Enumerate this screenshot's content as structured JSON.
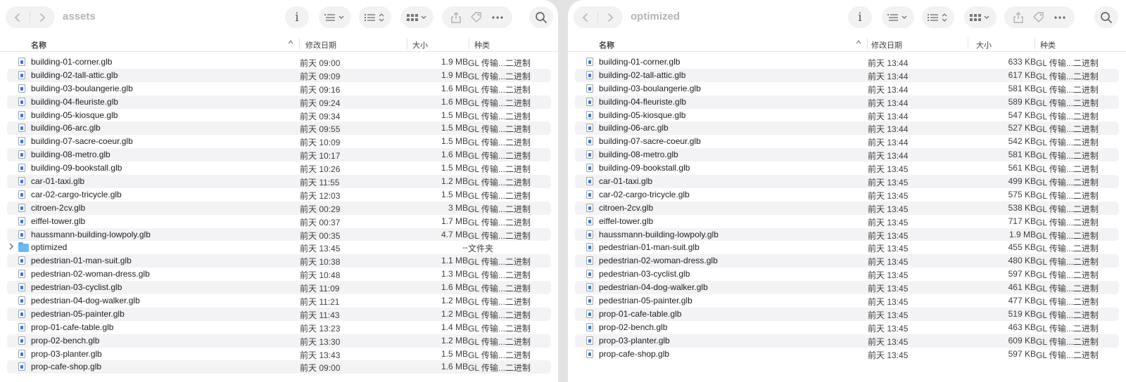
{
  "columns": {
    "name": "名称",
    "date": "修改日期",
    "size": "大小",
    "kind": "种类"
  },
  "left": {
    "title": "assets",
    "rows": [
      {
        "name": "building-01-corner.glb",
        "date": "前天 09:00",
        "size": "1.9 MB",
        "kind": "GL 传输...二进制",
        "type": "file"
      },
      {
        "name": "building-02-tall-attic.glb",
        "date": "前天 09:09",
        "size": "1.9 MB",
        "kind": "GL 传输...二进制",
        "type": "file"
      },
      {
        "name": "building-03-boulangerie.glb",
        "date": "前天 09:16",
        "size": "1.6 MB",
        "kind": "GL 传输...二进制",
        "type": "file"
      },
      {
        "name": "building-04-fleuriste.glb",
        "date": "前天 09:24",
        "size": "1.6 MB",
        "kind": "GL 传输...二进制",
        "type": "file"
      },
      {
        "name": "building-05-kiosque.glb",
        "date": "前天 09:34",
        "size": "1.5 MB",
        "kind": "GL 传输...二进制",
        "type": "file"
      },
      {
        "name": "building-06-arc.glb",
        "date": "前天 09:55",
        "size": "1.5 MB",
        "kind": "GL 传输...二进制",
        "type": "file"
      },
      {
        "name": "building-07-sacre-coeur.glb",
        "date": "前天 10:09",
        "size": "1.5 MB",
        "kind": "GL 传输...二进制",
        "type": "file"
      },
      {
        "name": "building-08-metro.glb",
        "date": "前天 10:17",
        "size": "1.6 MB",
        "kind": "GL 传输...二进制",
        "type": "file"
      },
      {
        "name": "building-09-bookstall.glb",
        "date": "前天 10:26",
        "size": "1.5 MB",
        "kind": "GL 传输...二进制",
        "type": "file"
      },
      {
        "name": "car-01-taxi.glb",
        "date": "前天 11:55",
        "size": "1.2 MB",
        "kind": "GL 传输...二进制",
        "type": "file"
      },
      {
        "name": "car-02-cargo-tricycle.glb",
        "date": "前天 12:03",
        "size": "1.5 MB",
        "kind": "GL 传输...二进制",
        "type": "file"
      },
      {
        "name": "citroen-2cv.glb",
        "date": "前天 00:29",
        "size": "3 MB",
        "kind": "GL 传输...二进制",
        "type": "file"
      },
      {
        "name": "eiffel-tower.glb",
        "date": "前天 00:37",
        "size": "1.7 MB",
        "kind": "GL 传输...二进制",
        "type": "file"
      },
      {
        "name": "haussmann-building-lowpoly.glb",
        "date": "前天 00:35",
        "size": "4.7 MB",
        "kind": "GL 传输...二进制",
        "type": "file"
      },
      {
        "name": "optimized",
        "date": "前天 13:45",
        "size": "--",
        "kind": "文件夹",
        "type": "folder"
      },
      {
        "name": "pedestrian-01-man-suit.glb",
        "date": "前天 10:38",
        "size": "1.1 MB",
        "kind": "GL 传输...二进制",
        "type": "file"
      },
      {
        "name": "pedestrian-02-woman-dress.glb",
        "date": "前天 10:48",
        "size": "1.3 MB",
        "kind": "GL 传输...二进制",
        "type": "file"
      },
      {
        "name": "pedestrian-03-cyclist.glb",
        "date": "前天 11:09",
        "size": "1.6 MB",
        "kind": "GL 传输...二进制",
        "type": "file"
      },
      {
        "name": "pedestrian-04-dog-walker.glb",
        "date": "前天 11:21",
        "size": "1.2 MB",
        "kind": "GL 传输...二进制",
        "type": "file"
      },
      {
        "name": "pedestrian-05-painter.glb",
        "date": "前天 11:43",
        "size": "1.2 MB",
        "kind": "GL 传输...二进制",
        "type": "file"
      },
      {
        "name": "prop-01-cafe-table.glb",
        "date": "前天 13:23",
        "size": "1.4 MB",
        "kind": "GL 传输...二进制",
        "type": "file"
      },
      {
        "name": "prop-02-bench.glb",
        "date": "前天 13:30",
        "size": "1.2 MB",
        "kind": "GL 传输...二进制",
        "type": "file"
      },
      {
        "name": "prop-03-planter.glb",
        "date": "前天 13:43",
        "size": "1.5 MB",
        "kind": "GL 传输...二进制",
        "type": "file"
      },
      {
        "name": "prop-cafe-shop.glb",
        "date": "前天 09:00",
        "size": "1.6 MB",
        "kind": "GL 传输...二进制",
        "type": "file"
      }
    ]
  },
  "right": {
    "title": "optimized",
    "rows": [
      {
        "name": "building-01-corner.glb",
        "date": "前天 13:44",
        "size": "633 KB",
        "kind": "GL 传输...二进制",
        "type": "file"
      },
      {
        "name": "building-02-tall-attic.glb",
        "date": "前天 13:44",
        "size": "617 KB",
        "kind": "GL 传输...二进制",
        "type": "file"
      },
      {
        "name": "building-03-boulangerie.glb",
        "date": "前天 13:44",
        "size": "581 KB",
        "kind": "GL 传输...二进制",
        "type": "file"
      },
      {
        "name": "building-04-fleuriste.glb",
        "date": "前天 13:44",
        "size": "589 KB",
        "kind": "GL 传输...二进制",
        "type": "file"
      },
      {
        "name": "building-05-kiosque.glb",
        "date": "前天 13:44",
        "size": "547 KB",
        "kind": "GL 传输...二进制",
        "type": "file"
      },
      {
        "name": "building-06-arc.glb",
        "date": "前天 13:44",
        "size": "527 KB",
        "kind": "GL 传输...二进制",
        "type": "file"
      },
      {
        "name": "building-07-sacre-coeur.glb",
        "date": "前天 13:44",
        "size": "542 KB",
        "kind": "GL 传输...二进制",
        "type": "file"
      },
      {
        "name": "building-08-metro.glb",
        "date": "前天 13:44",
        "size": "581 KB",
        "kind": "GL 传输...二进制",
        "type": "file"
      },
      {
        "name": "building-09-bookstall.glb",
        "date": "前天 13:45",
        "size": "561 KB",
        "kind": "GL 传输...二进制",
        "type": "file"
      },
      {
        "name": "car-01-taxi.glb",
        "date": "前天 13:45",
        "size": "499 KB",
        "kind": "GL 传输...二进制",
        "type": "file"
      },
      {
        "name": "car-02-cargo-tricycle.glb",
        "date": "前天 13:45",
        "size": "575 KB",
        "kind": "GL 传输...二进制",
        "type": "file"
      },
      {
        "name": "citroen-2cv.glb",
        "date": "前天 13:45",
        "size": "538 KB",
        "kind": "GL 传输...二进制",
        "type": "file"
      },
      {
        "name": "eiffel-tower.glb",
        "date": "前天 13:45",
        "size": "717 KB",
        "kind": "GL 传输...二进制",
        "type": "file"
      },
      {
        "name": "haussmann-building-lowpoly.glb",
        "date": "前天 13:45",
        "size": "1.9 MB",
        "kind": "GL 传输...二进制",
        "type": "file"
      },
      {
        "name": "pedestrian-01-man-suit.glb",
        "date": "前天 13:45",
        "size": "455 KB",
        "kind": "GL 传输...二进制",
        "type": "file"
      },
      {
        "name": "pedestrian-02-woman-dress.glb",
        "date": "前天 13:45",
        "size": "480 KB",
        "kind": "GL 传输...二进制",
        "type": "file"
      },
      {
        "name": "pedestrian-03-cyclist.glb",
        "date": "前天 13:45",
        "size": "597 KB",
        "kind": "GL 传输...二进制",
        "type": "file"
      },
      {
        "name": "pedestrian-04-dog-walker.glb",
        "date": "前天 13:45",
        "size": "461 KB",
        "kind": "GL 传输...二进制",
        "type": "file"
      },
      {
        "name": "pedestrian-05-painter.glb",
        "date": "前天 13:45",
        "size": "477 KB",
        "kind": "GL 传输...二进制",
        "type": "file"
      },
      {
        "name": "prop-01-cafe-table.glb",
        "date": "前天 13:45",
        "size": "519 KB",
        "kind": "GL 传输...二进制",
        "type": "file"
      },
      {
        "name": "prop-02-bench.glb",
        "date": "前天 13:45",
        "size": "463 KB",
        "kind": "GL 传输...二进制",
        "type": "file"
      },
      {
        "name": "prop-03-planter.glb",
        "date": "前天 13:45",
        "size": "609 KB",
        "kind": "GL 传输...二进制",
        "type": "file"
      },
      {
        "name": "prop-cafe-shop.glb",
        "date": "前天 13:45",
        "size": "597 KB",
        "kind": "GL 传输...二进制",
        "type": "file"
      }
    ]
  },
  "toolbar": {
    "info_glyph": "i"
  }
}
